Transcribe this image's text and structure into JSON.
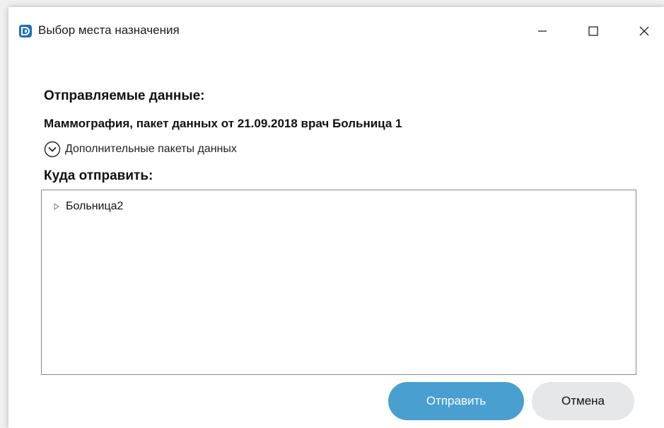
{
  "window": {
    "title": "Выбор места назначения",
    "icon": "app-logo-icon",
    "controls": {
      "minimize": "minimize-icon",
      "maximize": "maximize-icon",
      "close": "close-icon"
    }
  },
  "sent_data": {
    "heading": "Отправляемые данные:",
    "package": "Маммография,  пакет данных от 21.09.2018  врач Больница 1",
    "more_packages_label": "Дополнительные пакеты данных"
  },
  "destination": {
    "heading": "Куда отправить:",
    "tree_items": [
      {
        "label": "Больница2",
        "expanded": false
      }
    ]
  },
  "buttons": {
    "send_label": "Отправить",
    "cancel_label": "Отмена"
  },
  "colors": {
    "accent": "#4a9fd1",
    "secondary_button": "#e6e7e9",
    "app_icon": "#1e6fb8"
  }
}
